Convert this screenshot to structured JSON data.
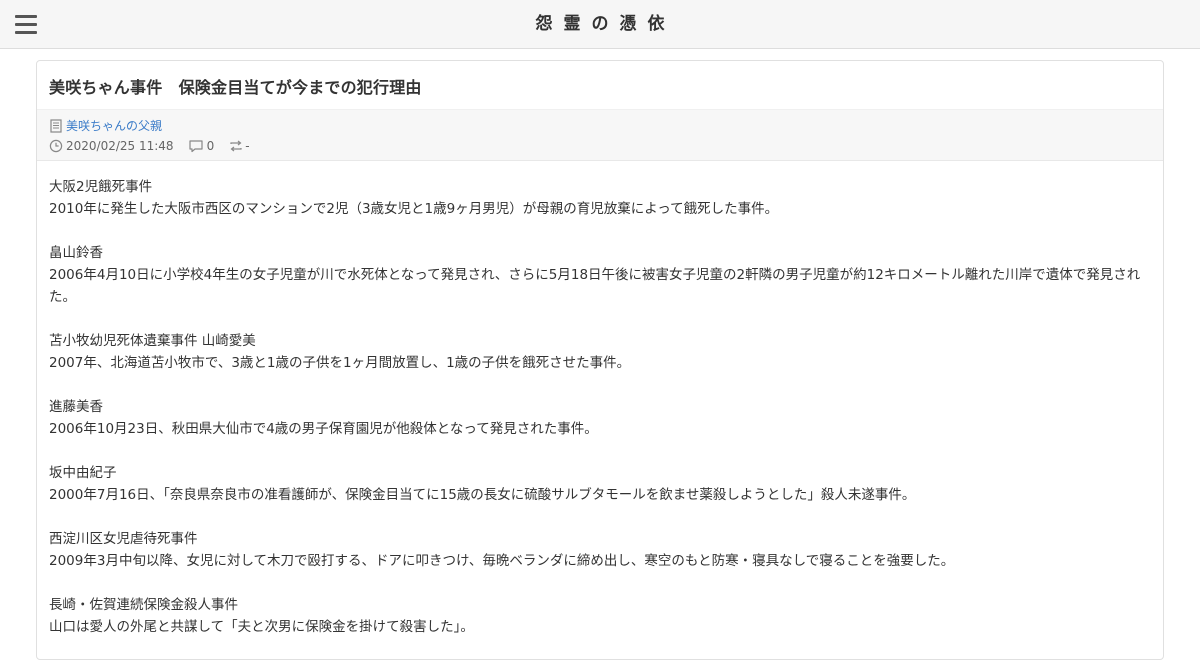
{
  "header": {
    "site_title": "怨霊の憑依"
  },
  "article": {
    "title": "美咲ちゃん事件　保険金目当てが今までの犯行理由",
    "author": "美咲ちゃんの父親",
    "timestamp": "2020/02/25 11:48",
    "comment_count": "0",
    "trackback": "-"
  },
  "entries": [
    {
      "heading": "大阪2児餓死事件",
      "text": "2010年に発生した大阪市西区のマンションで2児（3歳女児と1歳9ヶ月男児）が母親の育児放棄によって餓死した事件。"
    },
    {
      "heading": "畠山鈴香",
      "text": "2006年4月10日に小学校4年生の女子児童が川で水死体となって発見され、さらに5月18日午後に被害女子児童の2軒隣の男子児童が約12キロメートル離れた川岸で遺体で発見された。"
    },
    {
      "heading": "苫小牧幼児死体遺棄事件 山崎愛美",
      "text": "2007年、北海道苫小牧市で、3歳と1歳の子供を1ヶ月間放置し、1歳の子供を餓死させた事件。"
    },
    {
      "heading": "進藤美香",
      "text": "2006年10月23日、秋田県大仙市で4歳の男子保育園児が他殺体となって発見された事件。"
    },
    {
      "heading": "坂中由紀子",
      "text": "2000年7月16日、「奈良県奈良市の准看護師が、保険金目当てに15歳の長女に硫酸サルブタモールを飲ませ薬殺しようとした」殺人未遂事件。"
    },
    {
      "heading": "西淀川区女児虐待死事件",
      "text": "2009年3月中旬以降、女児に対して木刀で殴打する、ドアに叩きつけ、毎晩ベランダに締め出し、寒空のもと防寒・寝具なしで寝ることを強要した。"
    },
    {
      "heading": "長崎・佐賀連続保険金殺人事件",
      "text": "山口は愛人の外尾と共謀して「夫と次男に保険金を掛けて殺害した」。"
    }
  ]
}
